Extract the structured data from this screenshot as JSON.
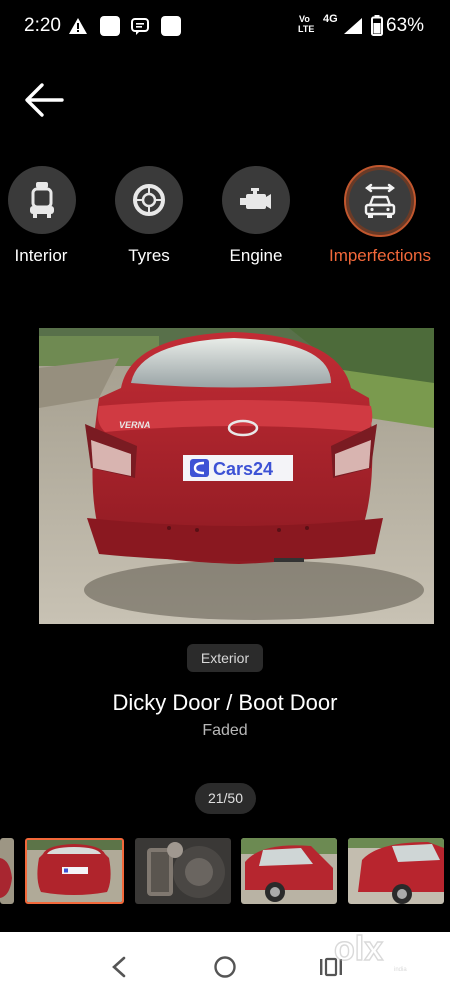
{
  "status_bar": {
    "time": "2:20",
    "network_top": "Vo",
    "network_bottom": "LTE",
    "network_gen": "4G",
    "battery": "63%"
  },
  "categories": [
    {
      "label": "Interior",
      "icon": "car-seat-icon",
      "active": false
    },
    {
      "label": "Tyres",
      "icon": "tyre-icon",
      "active": false
    },
    {
      "label": "Engine",
      "icon": "engine-icon",
      "active": false
    },
    {
      "label": "Imperfections",
      "icon": "car-wrench-icon",
      "active": true
    }
  ],
  "photo": {
    "badge_brand": "Cars24",
    "car_model_text": "VERNA"
  },
  "tag": "Exterior",
  "title": "Dicky Door / Boot Door",
  "subtitle": "Faded",
  "counter": "21/50",
  "thumbnails": 6,
  "watermark": "olx",
  "watermark_sub": "india",
  "colors": {
    "accent": "#f2683a",
    "background": "#000000",
    "circle": "#3a3a3a",
    "car_red": "#b0202a"
  }
}
